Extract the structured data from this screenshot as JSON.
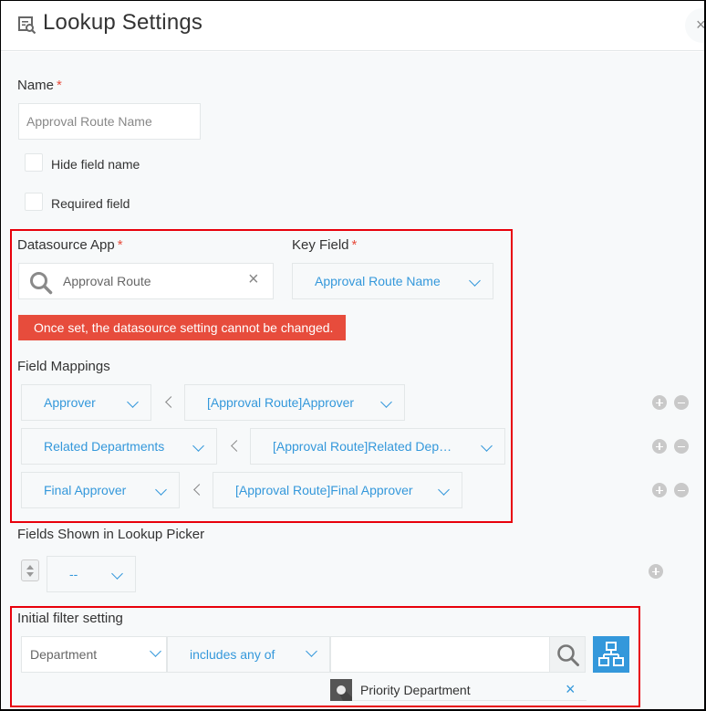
{
  "dialog": {
    "title": "Lookup Settings",
    "close_label": "×"
  },
  "name_field": {
    "label": "Name",
    "required_mark": "*",
    "value": "Approval Route Name"
  },
  "options": [
    {
      "label": "Hide field name",
      "checked": false
    },
    {
      "label": "Required field",
      "checked": false
    }
  ],
  "datasource": {
    "label": "Datasource App",
    "required_mark": "*",
    "value": "Approval Route",
    "clear_label": "×"
  },
  "key_field": {
    "label": "Key Field",
    "required_mark": "*",
    "value": "Approval Route Name"
  },
  "alert": {
    "text": "Once set, the datasource setting cannot be changed.",
    "color": "#e74c3c"
  },
  "field_mappings": {
    "label": "Field Mappings",
    "rows": [
      {
        "target": "Approver",
        "source": "[Approval Route]Approver"
      },
      {
        "target": "Related Departments",
        "source": "[Approval Route]Related Dep…"
      },
      {
        "target": "Final Approver",
        "source": "[Approval Route]Final Approver"
      }
    ]
  },
  "picker_fields": {
    "label": "Fields Shown in Lookup Picker",
    "value": "--"
  },
  "initial_filter": {
    "label": "Initial filter setting",
    "field": "Department",
    "operator": "includes any of",
    "search_value": "",
    "selected": [
      {
        "name": "Priority Department",
        "remove_label": "×"
      }
    ]
  },
  "colors": {
    "accent": "#3498db",
    "highlight_border": "#e8000b",
    "required": "#e74c3c",
    "background": "#f7f9fa"
  }
}
